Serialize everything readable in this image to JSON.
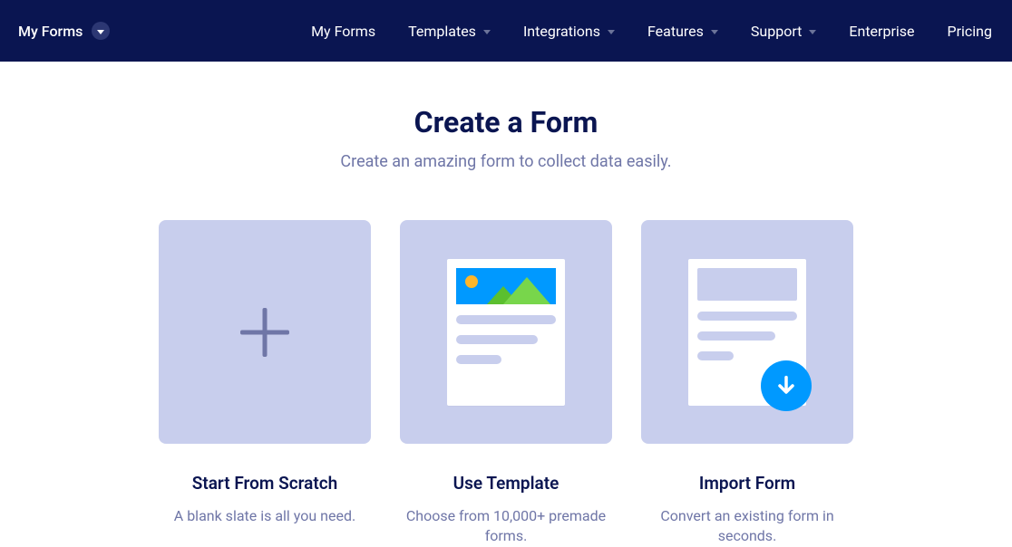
{
  "nav": {
    "breadcrumb": "My Forms",
    "items": [
      {
        "label": "My Forms",
        "hasDropdown": false
      },
      {
        "label": "Templates",
        "hasDropdown": true
      },
      {
        "label": "Integrations",
        "hasDropdown": true
      },
      {
        "label": "Features",
        "hasDropdown": true
      },
      {
        "label": "Support",
        "hasDropdown": true
      },
      {
        "label": "Enterprise",
        "hasDropdown": false
      },
      {
        "label": "Pricing",
        "hasDropdown": false
      }
    ]
  },
  "hero": {
    "title": "Create a Form",
    "subtitle": "Create an amazing form to collect data easily."
  },
  "cards": [
    {
      "title": "Start From Scratch",
      "subtitle": "A blank slate is all you need."
    },
    {
      "title": "Use Template",
      "subtitle": "Choose from 10,000+ premade forms."
    },
    {
      "title": "Import Form",
      "subtitle": "Convert an existing form in seconds."
    }
  ]
}
